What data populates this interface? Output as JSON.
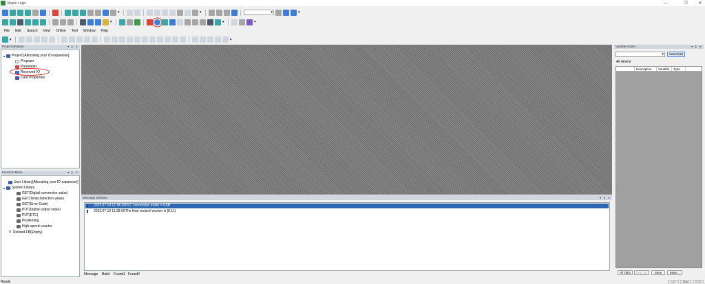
{
  "window": {
    "title": "Maple Logic",
    "minimize": "—",
    "restore": "❐",
    "close": "✕"
  },
  "menu": [
    "File",
    "Edit",
    "Search",
    "View",
    "Online",
    "Tool",
    "Window",
    "Help"
  ],
  "project_window": {
    "title": "Project Window",
    "root": "Project [Allocating your IO expansion]",
    "items": [
      "Program",
      "Parameter",
      "Reserved IO",
      "Card Properties"
    ]
  },
  "function_block": {
    "title": "Function Block",
    "user_library": "User Library[Allocating your IO expansion]",
    "system_library": "System Library",
    "items": [
      "GET(Digital conversion value)",
      "GET(Temp detection value)",
      "GET(Error Code)",
      "PUT(Digital output value)",
      "PUT(ETC)",
      "Positioning",
      "High-speed counter"
    ],
    "deleted": "Deleted FB(Empty)"
  },
  "message_window": {
    "title": "Message Window",
    "rows": [
      {
        "time": "2023.07.19 11:38:10",
        "text": "PLC connection mode = USB"
      },
      {
        "time": "2023.07.19 11:38:09",
        "text": "The final revised version is [8.11]."
      }
    ],
    "tabs": [
      "Message",
      "Build",
      "Found1",
      "Found2"
    ]
  },
  "variable_editor": {
    "title": "Variable Editor",
    "search_label": "Search(S)",
    "tab": "All device",
    "columns": [
      "",
      "Description",
      "Variable",
      "Type"
    ],
    "buttons": [
      "All Tabs",
      "Reg. list",
      "Save",
      "More..."
    ]
  },
  "status": {
    "text": "Ready",
    "indicators": [
      "CAP",
      "NUM",
      "SCRL"
    ]
  },
  "panel_controls": "▾ ❙ ✕"
}
